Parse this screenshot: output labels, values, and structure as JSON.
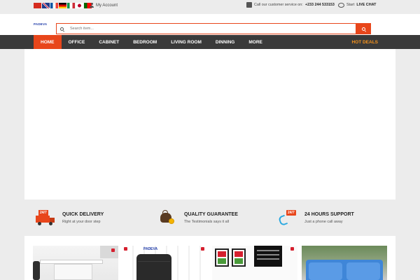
{
  "topbar": {
    "languages": [
      "Chinese",
      "English",
      "French",
      "German",
      "Italian",
      "Japanese",
      "Portuguese"
    ],
    "account_label": "My Account",
    "service_text": "Call our customer service on:",
    "service_phone": "+233 244 533153",
    "chat_prefix": "Start",
    "chat_label": "LIVE CHAT"
  },
  "header": {
    "logo_text": "PADEVA",
    "search_placeholder": "Search item..."
  },
  "nav": {
    "items": [
      "HOME",
      "OFFICE",
      "CABINET",
      "BEDROOM",
      "LIVING ROOM",
      "DINNING",
      "MORE"
    ],
    "active_index": 0,
    "hot_deals": "HOT DEALS"
  },
  "features": [
    {
      "title": "QUICK DELIVERY",
      "subtitle": "Right at your door step",
      "icon": "delivery-truck-icon",
      "badge": "24/7"
    },
    {
      "title": "QUALITY GUARANTEE",
      "subtitle": "The Testimonials says it all",
      "icon": "money-bag-icon"
    },
    {
      "title": "24 HOURS SUPPORT",
      "subtitle": "Just a phone call away",
      "icon": "support-phone-icon",
      "badge": "24/7"
    }
  ],
  "products": {
    "brand_text": "PADEVA"
  },
  "colors": {
    "accent": "#e8461b",
    "nav_bg": "#3a3a3a",
    "hot_deals": "#f7941d",
    "page_bg": "#ececec"
  }
}
